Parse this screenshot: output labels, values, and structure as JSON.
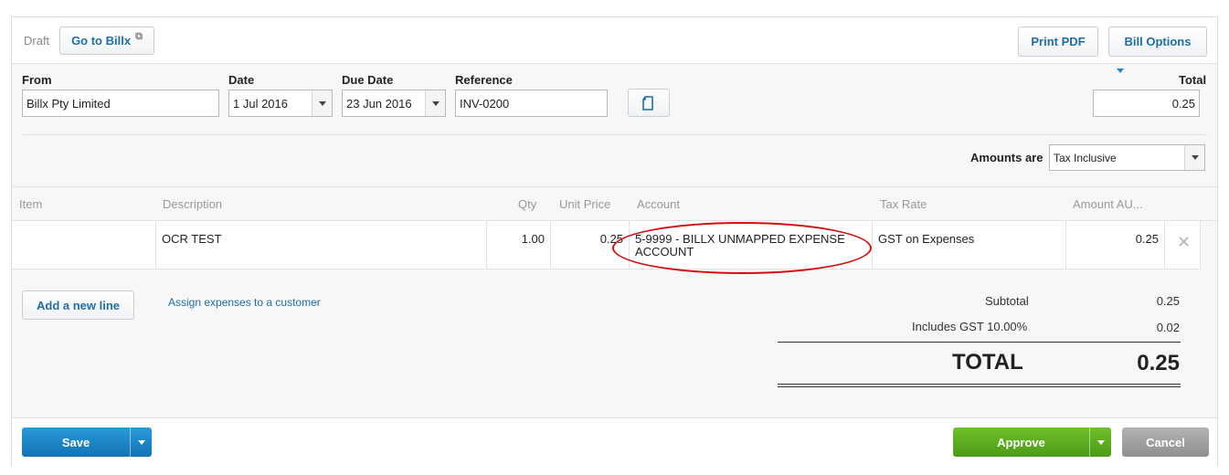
{
  "header": {
    "status": "Draft",
    "go_to_billx_label": "Go to Billx",
    "print_pdf_label": "Print PDF",
    "bill_options_label": "Bill Options"
  },
  "form": {
    "from_label": "From",
    "from_value": "Billx Pty Limited",
    "date_label": "Date",
    "date_value": "1 Jul 2016",
    "due_date_label": "Due Date",
    "due_date_value": "23 Jun 2016",
    "reference_label": "Reference",
    "reference_value": "INV-0200",
    "total_label": "Total",
    "total_value": "0.25"
  },
  "amounts": {
    "label": "Amounts are",
    "value": "Tax Inclusive"
  },
  "table": {
    "headers": [
      "Item",
      "Description",
      "Qty",
      "Unit Price",
      "Account",
      "Tax Rate",
      "Amount AU..."
    ],
    "rows": [
      {
        "item": "",
        "description": "OCR TEST",
        "qty": "1.00",
        "unit_price": "0.25",
        "account": "5-9999 - BILLX UNMAPPED EXPENSE ACCOUNT",
        "tax_rate": "GST on Expenses",
        "amount": "0.25"
      }
    ]
  },
  "actions": {
    "add_line_label": "Add a new line",
    "assign_expenses_label": "Assign expenses to a customer"
  },
  "totals": {
    "subtotal_label": "Subtotal",
    "subtotal_value": "0.25",
    "gst_label": "Includes GST 10.00%",
    "gst_value": "0.02",
    "total_label": "TOTAL",
    "total_value": "0.25"
  },
  "footer": {
    "save_label": "Save",
    "approve_label": "Approve",
    "cancel_label": "Cancel"
  },
  "colors": {
    "link": "#1d6fa5",
    "save": "#1b86c7",
    "approve": "#5aa820",
    "cancel": "#9a9a9a",
    "highlight": "#d40f0f"
  }
}
